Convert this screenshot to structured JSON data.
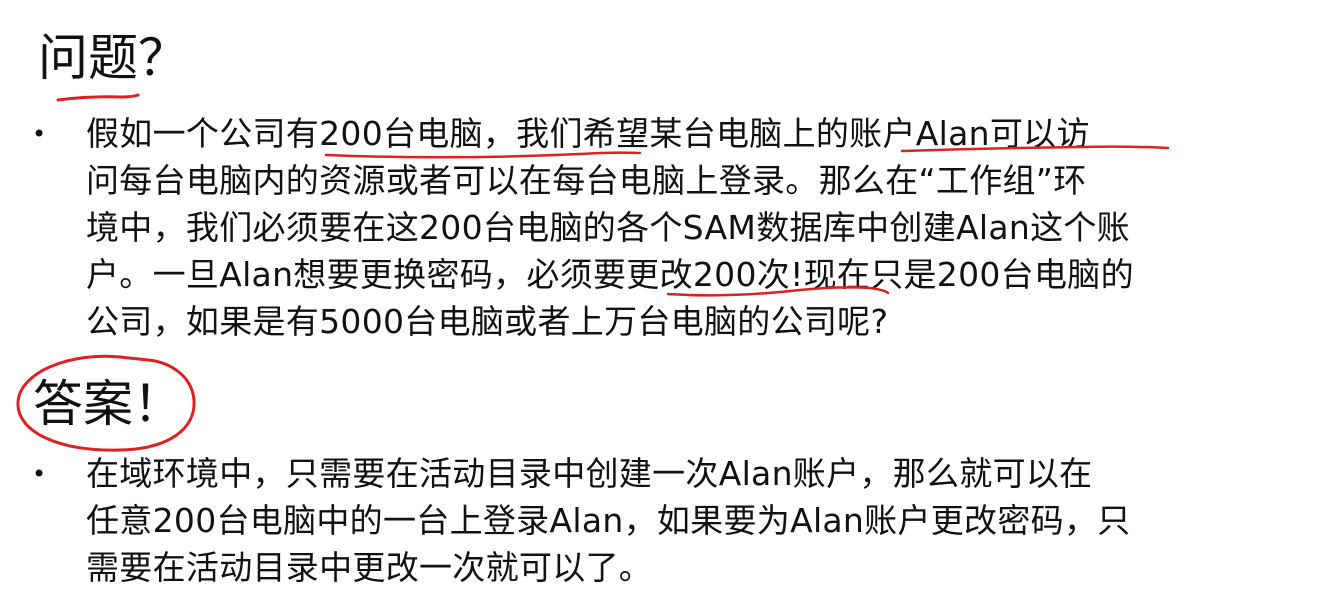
{
  "question_section": {
    "heading": "问题？",
    "bullet_symbol": "•",
    "lines": [
      "假如一个公司有200台电脑，我们希望某台电脑上的账户Alan可以访",
      "问每台电脑内的资源或者可以在每台电脑上登录。那么在“工作组”环",
      "境中，我们必须要在这200台电脑的各个SAM数据库中创建Alan这个账",
      "户。一旦Alan想要更换密码，必须要更改200次!现在只是200台电脑的",
      "公司，如果是有5000台电脑或者上万台电脑的公司呢?"
    ]
  },
  "answer_section": {
    "heading": "答案！",
    "bullet_symbol": "•",
    "lines": [
      "在域环境中，只需要在活动目录中创建一次Alan账户，那么就可以在",
      "任意200台电脑中的一台上登录Alan，如果要为Alan账户更改密码，只",
      "需要在活动目录中更改一次就可以了。"
    ]
  },
  "annotation_color": "#e02020"
}
